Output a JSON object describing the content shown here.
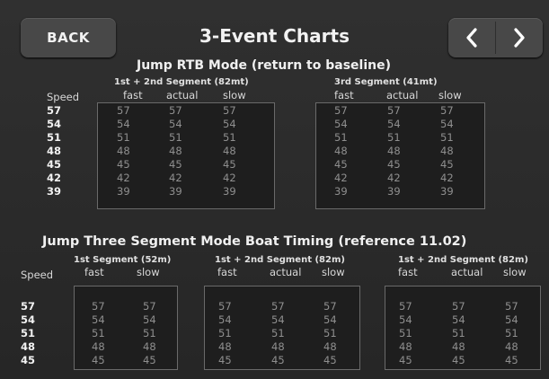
{
  "header": {
    "back_label": "BACK",
    "title": "3-Event Charts",
    "prev_icon": "chevron-left-icon",
    "next_icon": "chevron-right-icon"
  },
  "rtb": {
    "title": "Jump RTB Mode (return to baseline)",
    "speed_header": "Speed",
    "speeds": [
      "57",
      "54",
      "51",
      "48",
      "45",
      "42",
      "39"
    ],
    "tables": [
      {
        "label": "1st + 2nd Segment (82mt)",
        "columns": [
          {
            "header": "fast",
            "values": [
              "57",
              "54",
              "51",
              "48",
              "45",
              "42",
              "39"
            ]
          },
          {
            "header": "actual",
            "values": [
              "57",
              "54",
              "51",
              "48",
              "45",
              "42",
              "39"
            ]
          },
          {
            "header": "slow",
            "values": [
              "57",
              "54",
              "51",
              "48",
              "45",
              "42",
              "39"
            ]
          }
        ]
      },
      {
        "label": "3rd Segment (41mt)",
        "columns": [
          {
            "header": "fast",
            "values": [
              "57",
              "54",
              "51",
              "48",
              "45",
              "42",
              "39"
            ]
          },
          {
            "header": "actual",
            "values": [
              "57",
              "54",
              "51",
              "48",
              "45",
              "42",
              "39"
            ]
          },
          {
            "header": "slow",
            "values": [
              "57",
              "54",
              "51",
              "48",
              "45",
              "42",
              "39"
            ]
          }
        ]
      }
    ]
  },
  "three_seg": {
    "title": "Jump Three Segment Mode Boat Timing (reference 11.02)",
    "speed_header": "Speed",
    "speeds": [
      "57",
      "54",
      "51",
      "48",
      "45"
    ],
    "tables": [
      {
        "label": "1st Segment (52m)",
        "columns": [
          {
            "header": "fast",
            "values": [
              "57",
              "54",
              "51",
              "48",
              "45"
            ]
          },
          {
            "header": "slow",
            "values": [
              "57",
              "54",
              "51",
              "48",
              "45"
            ]
          }
        ]
      },
      {
        "label": "1st + 2nd Segment (82m)",
        "columns": [
          {
            "header": "fast",
            "values": [
              "57",
              "54",
              "51",
              "48",
              "45"
            ]
          },
          {
            "header": "actual",
            "values": [
              "57",
              "54",
              "51",
              "48",
              "45"
            ]
          },
          {
            "header": "slow",
            "values": [
              "57",
              "54",
              "51",
              "48",
              "45"
            ]
          }
        ]
      },
      {
        "label": "1st + 2nd Segment (82m)",
        "columns": [
          {
            "header": "fast",
            "values": [
              "57",
              "54",
              "51",
              "48",
              "45"
            ]
          },
          {
            "header": "actual",
            "values": [
              "57",
              "54",
              "51",
              "48",
              "45"
            ]
          },
          {
            "header": "slow",
            "values": [
              "57",
              "54",
              "51",
              "48",
              "45"
            ]
          }
        ]
      }
    ]
  }
}
